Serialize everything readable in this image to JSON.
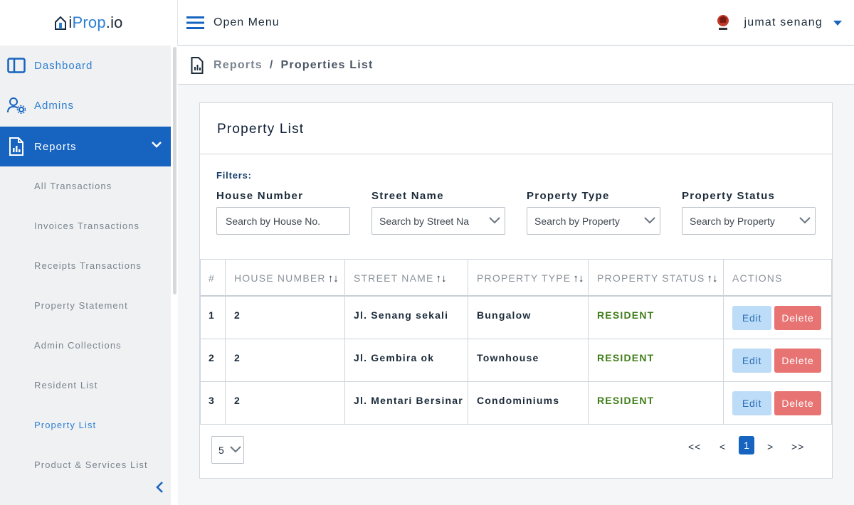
{
  "app": {
    "logo_i": "i",
    "logo_prop": "Prop",
    "logo_io": ".io"
  },
  "topbar": {
    "menu_label": "Open Menu",
    "user_name": "jumat senang"
  },
  "sidebar": {
    "items": [
      {
        "label": "Dashboard"
      },
      {
        "label": "Admins"
      },
      {
        "label": "Reports"
      }
    ],
    "reports_sub": [
      "All Transactions",
      "Invoices Transactions",
      "Receipts Transactions",
      "Property Statement",
      "Admin Collections",
      "Resident List",
      "Property List",
      "Product & Services List"
    ]
  },
  "breadcrumb": {
    "parent": "Reports",
    "separator": "/",
    "current": "Properties List"
  },
  "card": {
    "title": "Property List",
    "filters_label": "Filters:",
    "filters": [
      {
        "label": "House Number",
        "placeholder": "Search by House No."
      },
      {
        "label": "Street Name",
        "value": "Search by Street Na"
      },
      {
        "label": "Property Type",
        "value": "Search by Property"
      },
      {
        "label": "Property Status",
        "value": "Search by Property"
      }
    ]
  },
  "table": {
    "headers": [
      "#",
      "HOUSE NUMBER",
      "STREET NAME",
      "PROPERTY TYPE",
      "PROPERTY STATUS",
      "ACTIONS"
    ],
    "sort_glyph": "↑↓",
    "rows": [
      {
        "index": "1",
        "house": "2",
        "street": "Jl. Senang sekali",
        "type": "Bungalow",
        "status": "RESIDENT"
      },
      {
        "index": "2",
        "house": "2",
        "street": "Jl. Gembira ok",
        "type": "Townhouse",
        "status": "RESIDENT"
      },
      {
        "index": "3",
        "house": "2",
        "street": "Jl. Mentari Bersinar",
        "type": "Condominiums",
        "status": "RESIDENT"
      }
    ],
    "edit_label": "Edit",
    "delete_label": "Delete"
  },
  "pagination": {
    "page_size": "5",
    "first": "<<",
    "prev": "<",
    "current": "1",
    "next": ">",
    "last": ">>"
  },
  "colors": {
    "primary": "#1664c0",
    "link": "#2d7fd3",
    "status_resident": "#3f7d18",
    "delete": "#e87373",
    "edit_bg": "#bcdcf7"
  }
}
